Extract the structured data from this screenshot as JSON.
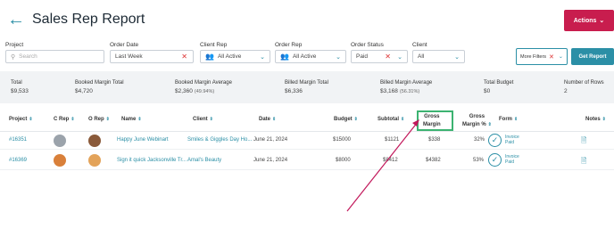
{
  "header": {
    "title": "Sales Rep Report",
    "actions_label": "Actions"
  },
  "filters": {
    "project": {
      "label": "Project",
      "placeholder": "Search"
    },
    "order_date": {
      "label": "Order Date",
      "value": "Last Week"
    },
    "client_rep": {
      "label": "Client Rep",
      "value": "All Active"
    },
    "order_rep": {
      "label": "Order Rep",
      "value": "All Active"
    },
    "order_status": {
      "label": "Order Status",
      "value": "Paid"
    },
    "client": {
      "label": "Client",
      "value": "All"
    },
    "more_filters_label": "More Filters",
    "get_report_label": "Get Report"
  },
  "summary": [
    {
      "label": "Total",
      "value": "$9,533",
      "pct": ""
    },
    {
      "label": "Booked Margin Total",
      "value": "$4,720",
      "pct": ""
    },
    {
      "label": "Booked Margin Average",
      "value": "$2,360",
      "pct": "(49.94%)"
    },
    {
      "label": "Billed Margin Total",
      "value": "$6,336",
      "pct": ""
    },
    {
      "label": "Billed Margin Average",
      "value": "$3,168",
      "pct": "(56.31%)"
    },
    {
      "label": "Total Budget",
      "value": "$0",
      "pct": ""
    },
    {
      "label": "Number of Rows",
      "value": "2",
      "pct": ""
    }
  ],
  "columns": {
    "project": "Project",
    "c_rep": "C Rep",
    "o_rep": "O Rep",
    "name": "Name",
    "client": "Client",
    "date": "Date",
    "budget": "Budget",
    "subtotal": "Subtotal",
    "gross_margin_1": "Gross",
    "gross_margin_2": "Margin",
    "gross_margin_pct_1": "Gross",
    "gross_margin_pct_2": "Margin %",
    "form": "Form",
    "notes": "Notes"
  },
  "rows": [
    {
      "project": "#16351",
      "name": "Happy June Webinart",
      "client": "Smiles & Giggles Day Ho...",
      "date": "June 21, 2024",
      "budget": "$15000",
      "subtotal": "$1121",
      "gross_margin": "$338",
      "gross_margin_pct": "32%",
      "form_1": "Invoice",
      "form_2": "Paid"
    },
    {
      "project": "#16369",
      "name": "Sign it quick Jacksonville Tr...",
      "client": "Amal's Beauty",
      "date": "June 21, 2024",
      "budget": "$8000",
      "subtotal": "$8412",
      "gross_margin": "$4382",
      "gross_margin_pct": "53%",
      "form_1": "Invoice",
      "form_2": "Paid"
    }
  ],
  "colors": {
    "accent": "#2b8fa6",
    "actions": "#c81d4e",
    "highlight": "#3cb371",
    "arrow": "#c2185b"
  }
}
